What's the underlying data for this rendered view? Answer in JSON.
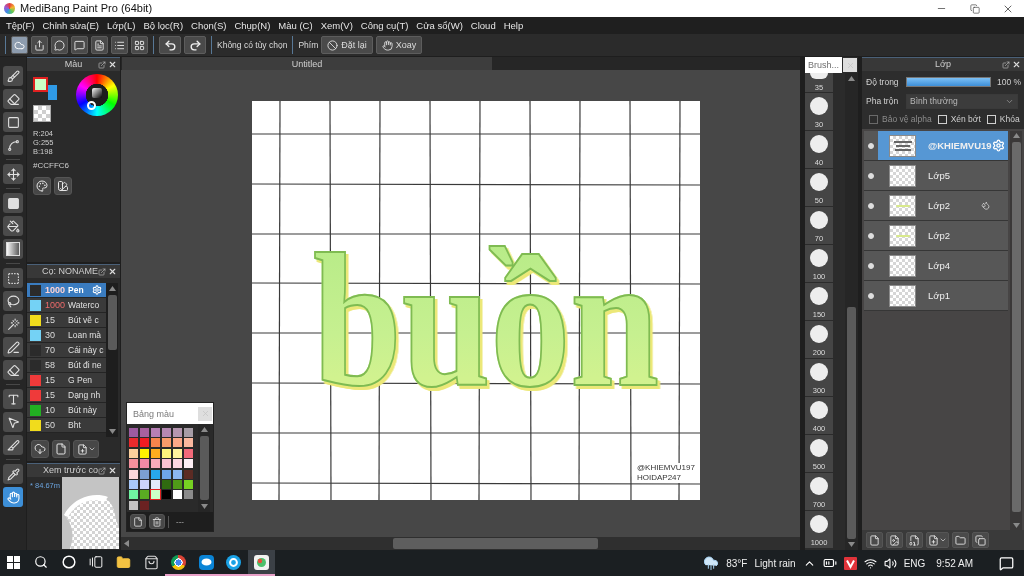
{
  "window": {
    "title": "MediBang Paint Pro (64bit)"
  },
  "menu": [
    "Tệp(F)",
    "Chỉnh sửa(E)",
    "Lớp(L)",
    "Bộ lọc(R)",
    "Chọn(S)",
    "Chụp(N)",
    "Màu (C)",
    "Xem(V)",
    "Công cụ(T)",
    "Cửa sổ(W)",
    "Cloud",
    "Help"
  ],
  "toolbar": {
    "status": "Không có tùy chọn",
    "key_label": "Phím",
    "buttons": [
      {
        "kind": "reset",
        "label": "Đặt lại"
      },
      {
        "kind": "rotate",
        "label": "Xoay"
      }
    ]
  },
  "tool_groups": [
    [
      {
        "kind": "brush",
        "selected": false
      },
      {
        "kind": "eraser",
        "selected": false
      },
      {
        "kind": "shape",
        "selected": false
      },
      {
        "kind": "polyline",
        "selected": false
      }
    ],
    [
      {
        "kind": "move",
        "selected": false
      }
    ],
    [
      {
        "kind": "fill",
        "selected": false
      },
      {
        "kind": "bucket",
        "selected": false
      },
      {
        "kind": "gradient",
        "selected": false
      }
    ],
    [
      {
        "kind": "select",
        "selected": false
      },
      {
        "kind": "lasso",
        "selected": false
      },
      {
        "kind": "wand",
        "selected": false
      },
      {
        "kind": "select-pen",
        "selected": false
      },
      {
        "kind": "select-eraser",
        "selected": false
      }
    ],
    [
      {
        "kind": "text",
        "selected": false
      },
      {
        "kind": "operation",
        "selected": false
      },
      {
        "kind": "divide",
        "selected": false
      }
    ],
    [
      {
        "kind": "eyedropper",
        "selected": false
      },
      {
        "kind": "hand",
        "selected": true
      }
    ]
  ],
  "color_panel": {
    "title": "Màu",
    "swatches": [
      {
        "kind": "foreground",
        "color": "#ccffc6"
      },
      {
        "kind": "background",
        "color": "#2f9ae6"
      }
    ],
    "rgb": [
      "R:204",
      "G:255",
      "B:198"
    ],
    "hex": "#CCFFC6"
  },
  "brush_panel": {
    "title": "Cọ: NONAME",
    "brushes": [
      {
        "color": "#2b2b2b",
        "size": "1000",
        "size_alert": true,
        "name": "Pen",
        "selected": true
      },
      {
        "color": "#74d2f5",
        "size": "1000",
        "size_alert": true,
        "name": "Waterco",
        "selected": false
      },
      {
        "color": "#f1dc1c",
        "size": "15",
        "size_alert": false,
        "name": "Bút vẽ c",
        "selected": false
      },
      {
        "color": "#74d2f5",
        "size": "30",
        "size_alert": false,
        "name": "Loan mà",
        "selected": false
      },
      {
        "color": "#2b2b2b",
        "size": "70",
        "size_alert": false,
        "name": "Cái này c",
        "selected": false
      },
      {
        "color": "#2b2b2b",
        "size": "58",
        "size_alert": false,
        "name": "Bút đi ne",
        "selected": false
      },
      {
        "color": "#ef3a3a",
        "size": "15",
        "size_alert": false,
        "name": "G Pen",
        "selected": false
      },
      {
        "color": "#ef3a3a",
        "size": "15",
        "size_alert": false,
        "name": "Dạng nh",
        "selected": false
      },
      {
        "color": "#22b022",
        "size": "10",
        "size_alert": false,
        "name": "Bút này",
        "selected": false
      },
      {
        "color": "#f1dc1c",
        "size": "50",
        "size_alert": false,
        "name": "Bht",
        "selected": false
      }
    ]
  },
  "preview_panel": {
    "title": "Xem trước co",
    "reading": "* 84.67m"
  },
  "document": {
    "tab": "Untitled",
    "lettering": "buồn",
    "signature": [
      "@KHIEMVU197",
      "HOIDAP247"
    ]
  },
  "palette": {
    "title": "Bảng màu",
    "footer": "---",
    "swatches": [
      {
        "color": "#9d5ba0",
        "selected": false
      },
      {
        "color": "#a8619f",
        "selected": false
      },
      {
        "color": "#b77fb5",
        "selected": false
      },
      {
        "color": "#b588b2",
        "selected": false
      },
      {
        "color": "#b596b0",
        "selected": false
      },
      {
        "color": "#a69ca6",
        "selected": false
      },
      {
        "color": "#ea2a2d",
        "selected": false
      },
      {
        "color": "#f01c22",
        "selected": false
      },
      {
        "color": "#f8844c",
        "selected": false
      },
      {
        "color": "#fa9c6a",
        "selected": false
      },
      {
        "color": "#fca888",
        "selected": false
      },
      {
        "color": "#fbb89f",
        "selected": false
      },
      {
        "color": "#fdcf9c",
        "selected": false
      },
      {
        "color": "#fff200",
        "selected": false
      },
      {
        "color": "#ffad1f",
        "selected": false
      },
      {
        "color": "#fff57c",
        "selected": false
      },
      {
        "color": "#fff29e",
        "selected": false
      },
      {
        "color": "#f26a7a",
        "selected": false
      },
      {
        "color": "#f5909c",
        "selected": false
      },
      {
        "color": "#f48aa5",
        "selected": false
      },
      {
        "color": "#f9abbb",
        "selected": false
      },
      {
        "color": "#fbc3d2",
        "selected": false
      },
      {
        "color": "#fcd6e1",
        "selected": false
      },
      {
        "color": "#fdeef5",
        "selected": false
      },
      {
        "color": "#fcd8da",
        "selected": false
      },
      {
        "color": "#7c9fd0",
        "selected": false
      },
      {
        "color": "#27a8ea",
        "selected": false
      },
      {
        "color": "#6ea5ea",
        "selected": false
      },
      {
        "color": "#8cb6f2",
        "selected": false
      },
      {
        "color": "#5c2b24",
        "selected": false
      },
      {
        "color": "#a9c9f9",
        "selected": false
      },
      {
        "color": "#cbd2f9",
        "selected": false
      },
      {
        "color": "#e4e9fb",
        "selected": false
      },
      {
        "color": "#2f6b10",
        "selected": false
      },
      {
        "color": "#4f9b18",
        "selected": false
      },
      {
        "color": "#76d122",
        "selected": false
      },
      {
        "color": "#70f2a2",
        "selected": false
      },
      {
        "color": "#5aab22",
        "selected": false
      },
      {
        "color": "#ccffc6",
        "selected": true
      },
      {
        "color": "#000000",
        "selected": false
      },
      {
        "color": "#ffffff",
        "selected": false
      },
      {
        "color": "#8a8a8a",
        "selected": false
      },
      {
        "color": "#c2c2c2",
        "selected": false
      },
      {
        "color": "#6b2222",
        "selected": false
      }
    ]
  },
  "brush_sizes": {
    "title": "Brush...",
    "items": [
      {
        "label": "35",
        "clipped": true
      },
      {
        "label": "30",
        "clipped": false
      },
      {
        "label": "40",
        "clipped": false
      },
      {
        "label": "50",
        "clipped": false
      },
      {
        "label": "70",
        "clipped": false
      },
      {
        "label": "100",
        "clipped": false
      },
      {
        "label": "150",
        "clipped": false
      },
      {
        "label": "200",
        "clipped": false
      },
      {
        "label": "300",
        "clipped": false
      },
      {
        "label": "400",
        "clipped": false
      },
      {
        "label": "500",
        "clipped": false
      },
      {
        "label": "700",
        "clipped": false
      },
      {
        "label": "1000",
        "clipped": false
      }
    ]
  },
  "layers_panel": {
    "title": "Lớp",
    "opacity": {
      "label": "Độ trong",
      "level": 1,
      "reading": "100 %"
    },
    "blend": {
      "label": "Pha trộn",
      "value": "Bình thường"
    },
    "options": [
      {
        "label": "Bảo vệ alpha",
        "checked": false,
        "disabled": true
      },
      {
        "label": "Xén bớt",
        "checked": false,
        "disabled": false
      },
      {
        "label": "Khóa",
        "checked": false,
        "disabled": false
      }
    ],
    "layers": [
      {
        "name": "@KHIEMVU19",
        "selected": true,
        "visible": true,
        "kind": "signature",
        "badge": false
      },
      {
        "name": "Lớp5",
        "selected": false,
        "visible": true,
        "kind": "blank",
        "badge": false
      },
      {
        "name": "Lớp2",
        "selected": false,
        "visible": true,
        "kind": "stroke",
        "badge": true
      },
      {
        "name": "Lớp2",
        "selected": false,
        "visible": true,
        "kind": "stroke",
        "badge": false
      },
      {
        "name": "Lớp4",
        "selected": false,
        "visible": true,
        "kind": "blank",
        "badge": false
      },
      {
        "name": "Lớp1",
        "selected": false,
        "visible": true,
        "kind": "blank",
        "badge": false
      }
    ]
  },
  "taskbar": {
    "apps": [
      {
        "kind": "folder",
        "running": false,
        "selected": false
      },
      {
        "kind": "bag",
        "running": false,
        "selected": false
      },
      {
        "kind": "browser",
        "running": true,
        "selected": false
      },
      {
        "kind": "chat",
        "running": true,
        "selected": false
      },
      {
        "kind": "call",
        "running": true,
        "selected": false
      },
      {
        "kind": "paint",
        "running": true,
        "selected": true
      }
    ],
    "weather": {
      "temperature": "83°F",
      "condition": "Light rain"
    },
    "language": "ENG",
    "time": "9:52 AM"
  }
}
